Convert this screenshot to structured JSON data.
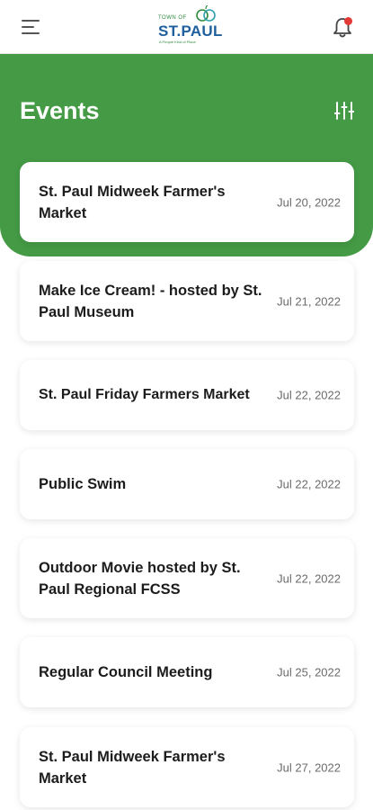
{
  "logo": {
    "town_of": "TOWN OF",
    "name": "ST.PAUL",
    "tagline": "A People Kind of Place"
  },
  "icons": {
    "menu": "hamburger-menu-icon",
    "bell": "bell-icon",
    "filter": "filter-sliders-icon"
  },
  "colors": {
    "brand_green": "#449a45",
    "badge_red": "#e53935",
    "logo_blue": "#1f5f9e"
  },
  "header": {
    "title": "Events"
  },
  "events": [
    {
      "title": "St. Paul Midweek Farmer's Market",
      "date": "Jul 20, 2022"
    },
    {
      "title": "Make Ice Cream! - hosted by St. Paul Museum",
      "date": "Jul 21, 2022"
    },
    {
      "title": "St. Paul Friday Farmers Market",
      "date": "Jul 22, 2022"
    },
    {
      "title": "Public Swim",
      "date": "Jul 22, 2022"
    },
    {
      "title": "Outdoor Movie hosted by St. Paul Regional FCSS",
      "date": "Jul 22, 2022"
    },
    {
      "title": "Regular Council Meeting",
      "date": "Jul 25, 2022"
    },
    {
      "title": "St. Paul Midweek Farmer's Market",
      "date": "Jul 27, 2022"
    }
  ]
}
